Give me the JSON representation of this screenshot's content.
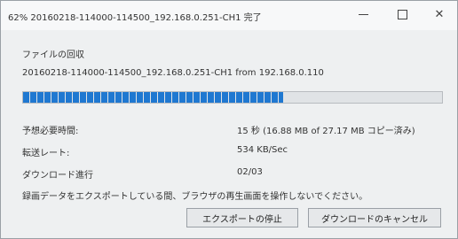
{
  "window": {
    "title": "62% 20160218-114000-114500_192.168.0.251-CH1 完了"
  },
  "dialog": {
    "heading": "ファイルの回収",
    "file_line": "20160218-114000-114500_192.168.0.251-CH1 from 192.168.0.110",
    "progress": {
      "fraction": 0.62
    },
    "time_label": "予想必要時間:",
    "time_value": "15 秒 (16.88 MB of 27.17 MB コピー済み)",
    "rate_label": "転送レート:",
    "rate_value": "534 KB/Sec",
    "download_label": "ダウンロード進行",
    "download_value": "02/03",
    "message": "録画データをエクスポートしている間、ブラウザの再生画面を操作しないでください。",
    "stop_button": "エクスポートの停止",
    "cancel_button": "ダウンロードのキャンセル"
  },
  "icons": {
    "minimize": "minimize-icon",
    "maximize": "maximize-icon",
    "close": "close-icon"
  },
  "colors": {
    "progress_accent": "#1f78d1"
  }
}
